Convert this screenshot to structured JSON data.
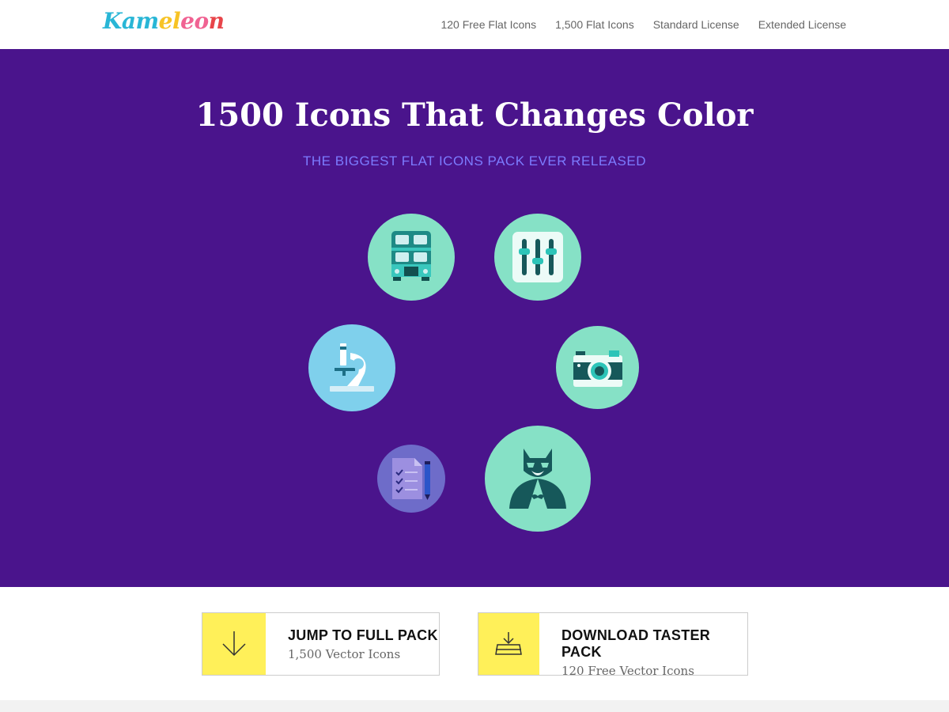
{
  "brand": {
    "logo_letters": [
      "K",
      "a",
      "m",
      "e",
      "l",
      "e",
      "o",
      "n"
    ],
    "logo_colors": [
      "#29b6d6",
      "#29b6d6",
      "#29b6d6",
      "#f7c325",
      "#f7c325",
      "#f06292",
      "#f06292",
      "#e8454a"
    ]
  },
  "nav": {
    "items": [
      "120 Free Flat Icons",
      "1,500 Flat Icons",
      "Standard License",
      "Extended License"
    ]
  },
  "hero": {
    "title": "1500 Icons That Changes Color",
    "subtitle": "THE BIGGEST FLAT ICONS PACK EVER RELEASED",
    "background": "#4a148c",
    "icons": [
      "bus-icon",
      "equalizer-icon",
      "microscope-icon",
      "camera-icon",
      "checklist-icon",
      "masked-hero-icon"
    ]
  },
  "cta": {
    "full_pack": {
      "title": "JUMP TO FULL PACK",
      "subtitle": "1,500 Vector Icons",
      "icon": "arrow-down-icon"
    },
    "taster_pack": {
      "title": "DOWNLOAD TASTER PACK",
      "subtitle": "120 Free Vector Icons",
      "icon": "download-tray-icon"
    }
  },
  "colors": {
    "accent_yellow": "#fff059",
    "mint": "#86e1c6",
    "sky": "#7fd0ec",
    "lavender": "#6e6cc9",
    "subtitle": "#7c7cff"
  }
}
